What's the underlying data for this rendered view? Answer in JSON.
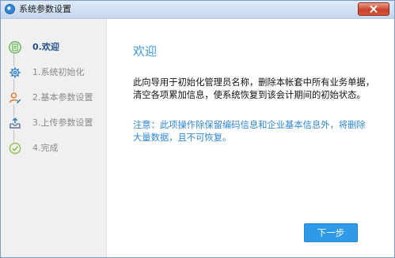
{
  "window": {
    "title": "系统参数设置",
    "icon": "app-icon",
    "close_icon": "close-icon"
  },
  "sidebar": {
    "steps": [
      {
        "label": "0.欢迎",
        "icon": "document-icon",
        "active": true
      },
      {
        "label": "1.系统初始化",
        "icon": "gear-icon",
        "active": false
      },
      {
        "label": "2.基本参数设置",
        "icon": "user-edit-icon",
        "active": false
      },
      {
        "label": "3.上传参数设置",
        "icon": "upload-tray-icon",
        "active": false
      },
      {
        "label": "4.完成",
        "icon": "check-circle-icon",
        "active": false
      }
    ]
  },
  "main": {
    "title": "欢迎",
    "description": "此向导用于初始化管理员名称，删除本帐套中所有业务单据，清空各项累加信息，使系统恢复到该会计期间的初始状态。",
    "note": "注意：此项操作除保留编码信息和企业基本信息外，将删除大量数据，且不可恢复。"
  },
  "footer": {
    "next_label": "下一步"
  },
  "colors": {
    "accent": "#2f9ae8",
    "title_blue": "#3b9be0",
    "note_blue": "#2f86d6",
    "active_step": "#1f4f8f",
    "inactive_step": "#8a8a8a",
    "sidebar_bg": "#f0f0f0",
    "close_red": "#c8412a"
  }
}
